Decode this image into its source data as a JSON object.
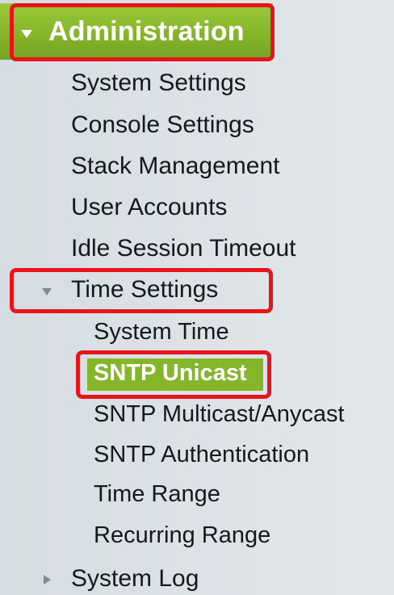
{
  "nav": {
    "section": {
      "label": "Administration",
      "expanded": true,
      "color": "#85b52a"
    },
    "items": [
      {
        "label": "System Settings"
      },
      {
        "label": "Console Settings"
      },
      {
        "label": "Stack Management"
      },
      {
        "label": "User Accounts"
      },
      {
        "label": "Idle Session Timeout"
      },
      {
        "label": "Time Settings",
        "expanded": true,
        "children": [
          {
            "label": "System Time"
          },
          {
            "label": "SNTP Unicast",
            "selected": true
          },
          {
            "label": "SNTP Multicast/Anycast"
          },
          {
            "label": "SNTP Authentication"
          },
          {
            "label": "Time Range"
          },
          {
            "label": "Recurring Range"
          }
        ]
      },
      {
        "label": "System Log",
        "expanded": false
      }
    ]
  },
  "highlight_color": "#e8141c",
  "icons": {
    "expanded": "triangle-down-icon",
    "collapsed": "triangle-right-icon"
  }
}
